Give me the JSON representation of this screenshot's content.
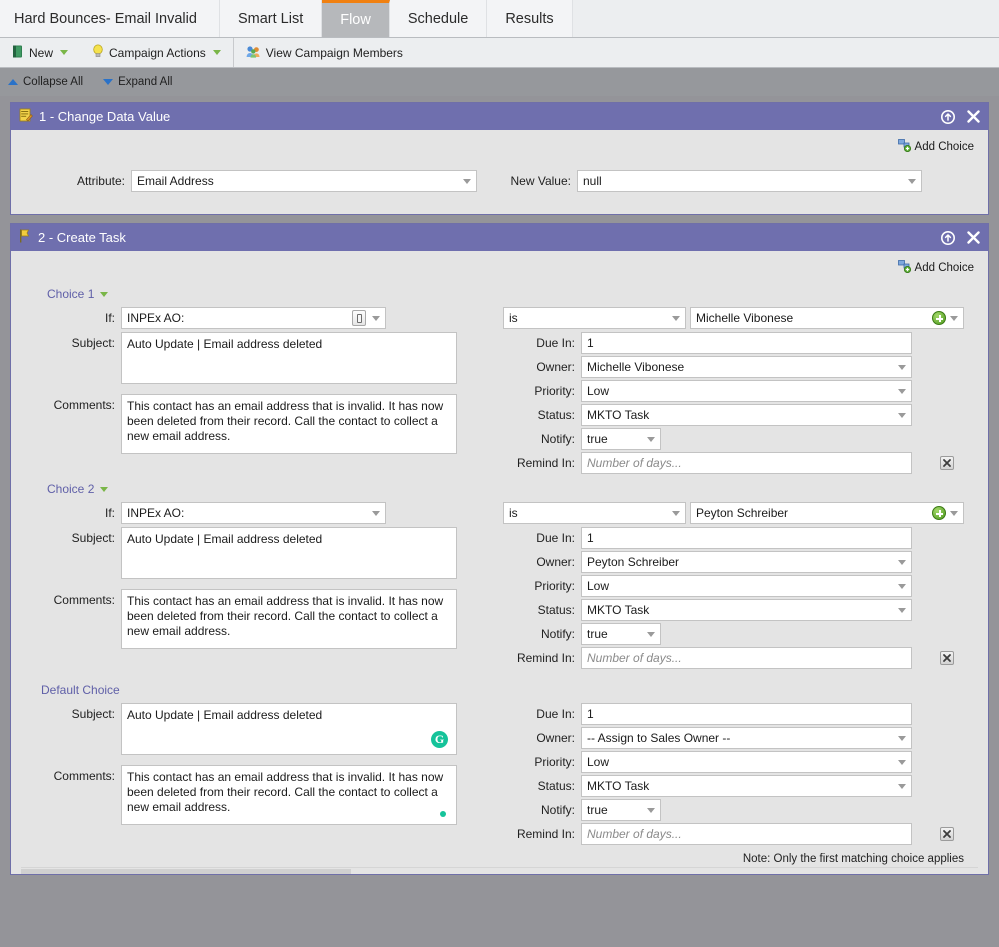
{
  "tabs": [
    {
      "label": "Hard Bounces- Email Invalid",
      "active": false
    },
    {
      "label": "Smart List",
      "active": false
    },
    {
      "label": "Flow",
      "active": true
    },
    {
      "label": "Schedule",
      "active": false
    },
    {
      "label": "Results",
      "active": false
    }
  ],
  "actionbar": {
    "new_label": "New",
    "campaign_actions_label": "Campaign Actions",
    "view_members_label": "View Campaign Members"
  },
  "subbar": {
    "collapse_all": "Collapse All",
    "expand_all": "Expand All"
  },
  "common": {
    "add_choice": "Add Choice",
    "label_if": "If:",
    "label_subject": "Subject:",
    "label_comments": "Comments:",
    "label_due_in": "Due In:",
    "label_owner": "Owner:",
    "label_priority": "Priority:",
    "label_status": "Status:",
    "label_notify": "Notify:",
    "label_remind_in": "Remind In:",
    "remind_placeholder": "Number of days...",
    "note": "Note: Only the first matching choice applies",
    "subject_text": "Auto Update | Email address deleted",
    "comments_text": "This contact has an email address that is invalid. It has now been deleted from their record. Call the contact to collect a new email address."
  },
  "step1": {
    "title": "1 - Change Data Value",
    "icon": "change-data-value-icon",
    "attribute_label": "Attribute:",
    "attribute_value": "Email Address",
    "new_value_label": "New Value:",
    "new_value": "null"
  },
  "step2": {
    "title": "2 - Create Task",
    "icon": "create-task-flag-icon",
    "choices": [
      {
        "label": "Choice 1",
        "if_field": "INPEx AO:",
        "if_operator": "is",
        "if_value": "Michelle Vibonese",
        "has_token_button": true,
        "subject": "Auto Update | Email address deleted",
        "comments": "This contact has an email address that is invalid. It has now been deleted from their record. Call the contact to collect a new email address.",
        "due_in": "1",
        "owner": "Michelle Vibonese",
        "priority": "Low",
        "status": "MKTO Task",
        "notify": "true",
        "remind_in": ""
      },
      {
        "label": "Choice 2",
        "if_field": "INPEx AO:",
        "if_operator": "is",
        "if_value": "Peyton Schreiber",
        "has_token_button": false,
        "subject": "Auto Update | Email address deleted",
        "comments": "This contact has an email address that is invalid. It has now been deleted from their record. Call the contact to collect a new email address.",
        "due_in": "1",
        "owner": "Peyton Schreiber",
        "priority": "Low",
        "status": "MKTO Task",
        "notify": "true",
        "remind_in": ""
      }
    ],
    "default_choice": {
      "label": "Default Choice",
      "subject": "Auto Update | Email address deleted",
      "comments": "This contact has an email address that is invalid. It has now been deleted from their record. Call the contact to collect a new email address.",
      "due_in": "1",
      "owner": "-- Assign to Sales Owner --",
      "priority": "Low",
      "status": "MKTO Task",
      "notify": "true",
      "remind_in": ""
    }
  },
  "colors": {
    "panel_header": "#6f6fae",
    "active_tab_accent": "#f08010",
    "page_background": "#949499",
    "panel_body": "#e4e4e4",
    "choice_link": "#6060a8",
    "grammarly_green": "#15c39a"
  }
}
